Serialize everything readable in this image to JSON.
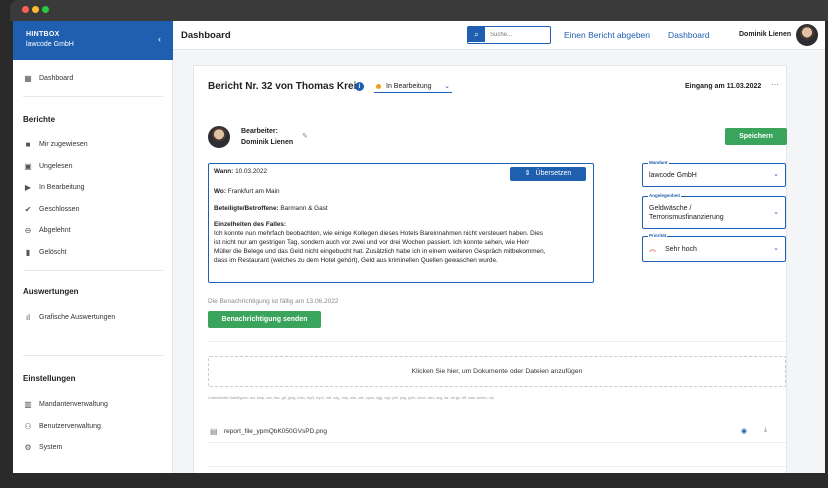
{
  "window": {
    "controls": [
      "close",
      "minimize",
      "maximize"
    ]
  },
  "brand": {
    "name": "HINTBOX",
    "org": "lawcode GmbH",
    "collapse_icon": "chevron-left-icon"
  },
  "header": {
    "page_title": "Dashboard",
    "search_placeholder": "Suche...",
    "link_report": "Einen Bericht abgeben",
    "link_dashboard": "Dashboard",
    "user_name": "Dominik Lienen"
  },
  "sidebar": {
    "dashboard": {
      "label": "Dashboard",
      "icon": "dashboard-icon"
    },
    "sections": {
      "berichte": "Berichte",
      "auswertungen": "Auswertungen",
      "einstellungen": "Einstellungen"
    },
    "berichte_items": [
      {
        "label": "Mir zugewiesen",
        "icon": "person-icon"
      },
      {
        "label": "Ungelesen",
        "icon": "inbox-icon"
      },
      {
        "label": "In Bearbeitung",
        "icon": "play-icon"
      },
      {
        "label": "Geschlossen",
        "icon": "check-circle-icon"
      },
      {
        "label": "Abgelehnt",
        "icon": "minus-circle-icon"
      },
      {
        "label": "Gelöscht",
        "icon": "trash-icon"
      }
    ],
    "auswertungen_items": [
      {
        "label": "Grafische Auswertungen",
        "icon": "bar-chart-icon"
      }
    ],
    "einstellungen_items": [
      {
        "label": "Mandantenverwaltung",
        "icon": "building-icon"
      },
      {
        "label": "Benutzerverwaltung",
        "icon": "users-icon"
      },
      {
        "label": "System",
        "icon": "gear-icon"
      }
    ]
  },
  "report": {
    "title": "Bericht Nr. 32 von Thomas Kreis",
    "status": "In Bearbeitung",
    "status_color": "#f0a020",
    "received": "Eingang am 11.03.2022",
    "assignee_label": "Bearbeiter:",
    "assignee_name": "Dominik Lienen",
    "save_label": "Speichern",
    "translate_label": "Übersetzen",
    "when_label": "Wann:",
    "when_value": "10.03.2022",
    "where_label": "Wo:",
    "where_value": "Frankfurt am Main",
    "involved_label": "Beteiligte/Betroffene:",
    "involved_value": "Barmann & Gast",
    "details_label": "Einzelheiten des Falles:",
    "details_lines": [
      "Ich konnte nun mehrfach beobachten, wie einige Kollegen dieses Hotels Bareinnahmen nicht versteuert haben. Dies",
      "ist nicht nur am gestrigen Tag, sondern auch vor zwei und vor drei Wochen passiert. Ich konnte sehen, wie Herr",
      "Müller die Belege und das Geld nicht eingebucht hat. Zusätzlich habe ich in einem weiteren Gespräch mitbekommen,",
      "dass im Restaurant (welches zu dem Hotel gehört), Geld aus kriminellen Quellen gewaschen wurde."
    ],
    "due_text": "Die Benachrichtigung ist fällig am 13.06.2022",
    "notify_label": "Benachrichtigung senden",
    "mandant": {
      "label": "Mandant",
      "value": "lawcode GmbH"
    },
    "category": {
      "label": "Angelegenheit",
      "value_line1": "Geldwäsche /",
      "value_line2": "Terrorismusfinanzierung"
    },
    "priority": {
      "label": "Priorität",
      "value": "Sehr hoch",
      "icon": "double-chevron-up-icon",
      "color": "#d9423a"
    },
    "dropzone_text": "Klicken Sie hier, um Dokumente oder Dateien anzufügen",
    "file_types": "Unterstützte Dateitypen: avi, bmp, csv, flac, gif, jpeg, m4a, mp3, mp4, odf, odg, odp, ods, odt, opus, ogg, ogv, pdf, png, pptx, docx, xlsx, svg, tar, tar.gz, tiff, wav, webm, zip",
    "file_name": "report_file_ypmQbK050GVsPD.png"
  }
}
